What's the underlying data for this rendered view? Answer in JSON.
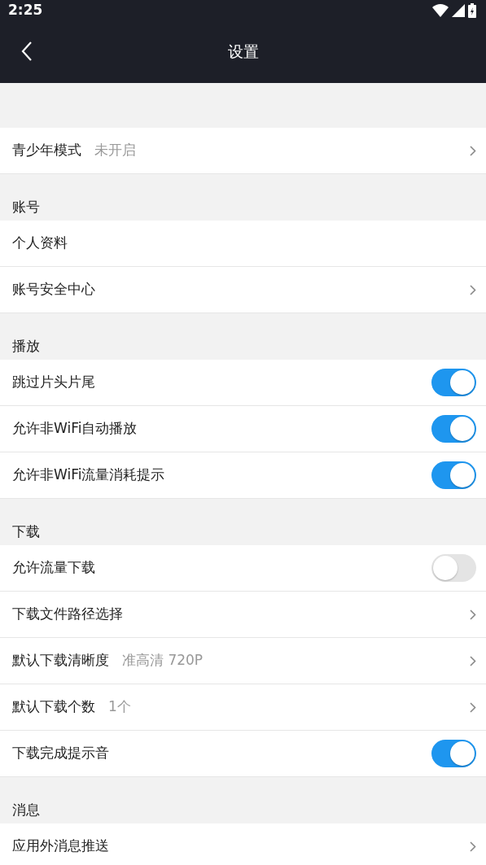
{
  "status_bar": {
    "time": "2:25"
  },
  "header": {
    "title": "设置"
  },
  "sections": [
    {
      "items": [
        {
          "kind": "link",
          "label": "青少年模式",
          "value": "未开启"
        }
      ]
    },
    {
      "title": "账号",
      "items": [
        {
          "kind": "plain",
          "label": "个人资料"
        },
        {
          "kind": "link",
          "label": "账号安全中心"
        }
      ]
    },
    {
      "title": "播放",
      "items": [
        {
          "kind": "toggle",
          "label": "跳过片头片尾",
          "on": true
        },
        {
          "kind": "toggle",
          "label": "允许非WiFi自动播放",
          "on": true
        },
        {
          "kind": "toggle",
          "label": "允许非WiFi流量消耗提示",
          "on": true
        }
      ]
    },
    {
      "title": "下载",
      "items": [
        {
          "kind": "toggle",
          "label": "允许流量下载",
          "on": false
        },
        {
          "kind": "link",
          "label": "下载文件路径选择"
        },
        {
          "kind": "link",
          "label": "默认下载清晰度",
          "value": "准高清 720P"
        },
        {
          "kind": "link",
          "label": "默认下载个数",
          "value": "1个"
        },
        {
          "kind": "toggle",
          "label": "下载完成提示音",
          "on": true
        }
      ]
    },
    {
      "title": "消息",
      "items": [
        {
          "kind": "link",
          "label": "应用外消息推送"
        }
      ]
    }
  ]
}
